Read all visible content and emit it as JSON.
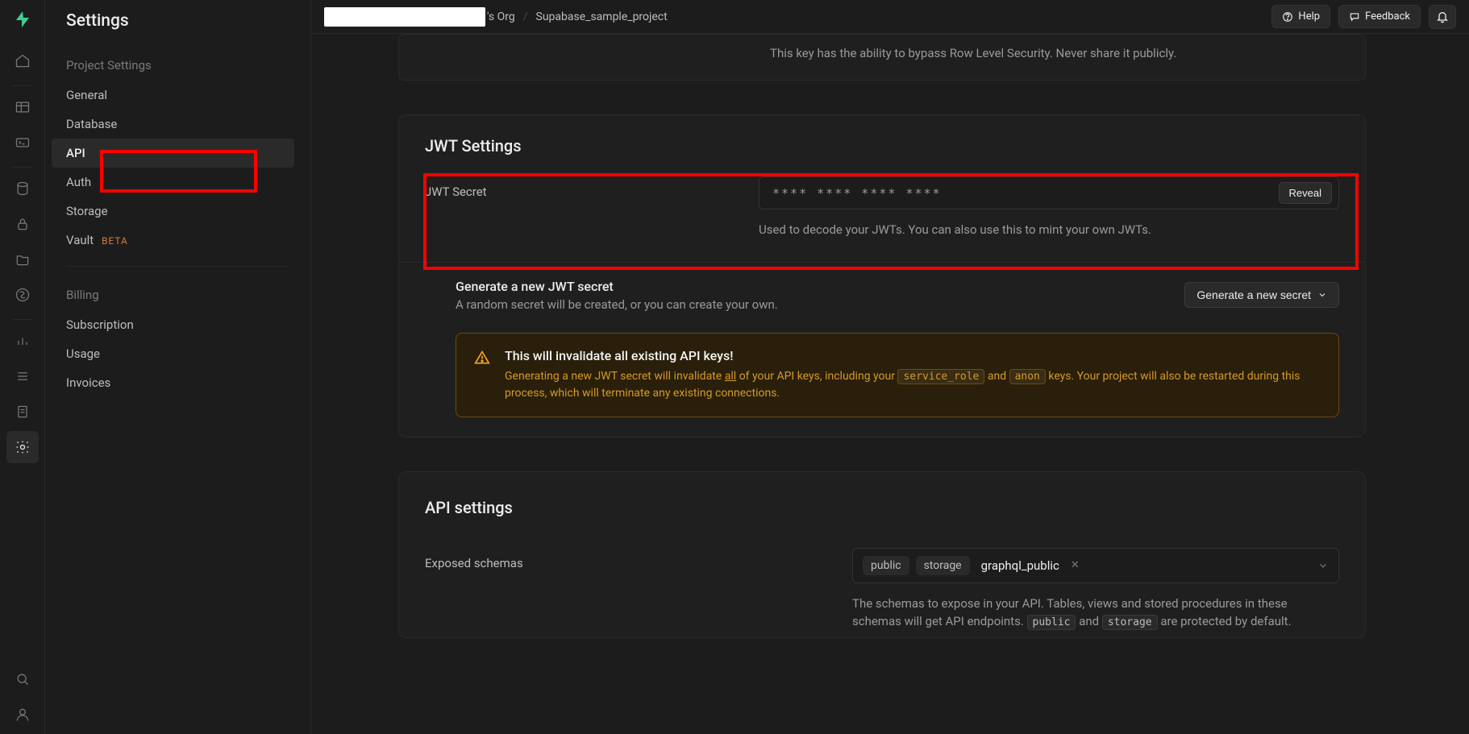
{
  "topbar": {
    "org_suffix": "'s Org",
    "project": "Supabase_sample_project",
    "help": "Help",
    "feedback": "Feedback"
  },
  "sidebar": {
    "title": "Settings",
    "group1": "Project Settings",
    "items1": [
      {
        "label": "General"
      },
      {
        "label": "Database"
      },
      {
        "label": "API",
        "active": true
      },
      {
        "label": "Auth"
      },
      {
        "label": "Storage"
      },
      {
        "label": "Vault",
        "beta": "BETA"
      }
    ],
    "group2": "Billing",
    "items2": [
      {
        "label": "Subscription"
      },
      {
        "label": "Usage"
      },
      {
        "label": "Invoices"
      }
    ]
  },
  "prev_note": "This key has the ability to bypass Row Level Security. Never share it publicly.",
  "jwt": {
    "header": "JWT Settings",
    "secret_label": "JWT Secret",
    "secret_value": "****  ****  ****  ****",
    "reveal": "Reveal",
    "secret_help": "Used to decode your JWTs. You can also use this to mint your own JWTs.",
    "gen_title": "Generate a new JWT secret",
    "gen_sub": "A random secret will be created, or you can create your own.",
    "gen_btn": "Generate a new secret",
    "warn_title": "This will invalidate all existing API keys!",
    "warn_pre": "Generating a new JWT secret will invalidate ",
    "warn_all": "all",
    "warn_mid1": " of your API keys, including your ",
    "warn_code1": "service_role",
    "warn_and": " and ",
    "warn_code2": "anon",
    "warn_post": " keys. Your project will also be restarted during this process, which will terminate any existing connections."
  },
  "api": {
    "header": "API settings",
    "schemas_label": "Exposed schemas",
    "tags": [
      "public",
      "storage"
    ],
    "value": "graphql_public",
    "help_pre": "The schemas to expose in your API. Tables, views and stored procedures in these schemas will get API endpoints. ",
    "help_c1": "public",
    "help_and": " and ",
    "help_c2": "storage",
    "help_post": " are protected by default."
  }
}
